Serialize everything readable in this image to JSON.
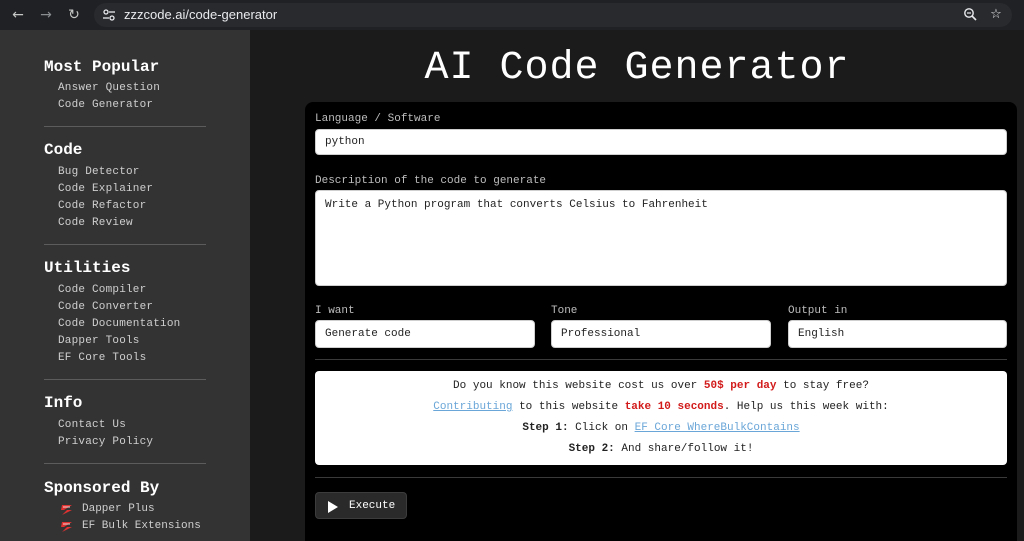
{
  "browser": {
    "url_domain": "zzzcode.ai",
    "url_path": "/code-generator",
    "icons": [
      "back-arrow-icon",
      "forward-arrow-icon",
      "reload-icon",
      "site-settings-icon",
      "zoom-icon",
      "star-icon"
    ]
  },
  "sidebar": {
    "sections": [
      {
        "title": "Most Popular",
        "links": [
          "Answer Question",
          "Code Generator"
        ]
      },
      {
        "title": "Code",
        "links": [
          "Bug Detector",
          "Code Explainer",
          "Code Refactor",
          "Code Review"
        ]
      },
      {
        "title": "Utilities",
        "links": [
          "Code Compiler",
          "Code Converter",
          "Code Documentation",
          "Dapper Tools",
          "EF Core Tools"
        ]
      },
      {
        "title": "Info",
        "links": [
          "Contact Us",
          "Privacy Policy"
        ]
      }
    ],
    "sponsored": {
      "title": "Sponsored By",
      "links": [
        "Dapper Plus",
        "EF Bulk Extensions"
      ]
    }
  },
  "main": {
    "title": "AI Code Generator",
    "form": {
      "language_label": "Language / Software",
      "language_value": "python",
      "description_label": "Description of the code to generate",
      "description_value": "Write a Python program that converts Celsius to Fahrenheit",
      "want_label": "I want",
      "want_value": "Generate code",
      "tone_label": "Tone",
      "tone_value": "Professional",
      "output_label": "Output in",
      "output_value": "English"
    },
    "notice": {
      "line1_pre": "Do you know this website cost us over ",
      "line1_highlight": "50$ per day",
      "line1_post": " to stay free?",
      "line2_link": "Contributing",
      "line2_mid": " to this website ",
      "line2_highlight": "take 10 seconds",
      "line2_post": ". Help us this week with:",
      "step1_label": "Step 1:",
      "step1_text": " Click on ",
      "step1_link": "EF Core WhereBulkContains",
      "step2_label": "Step 2:",
      "step2_text": " And share/follow it!"
    },
    "execute_label": "Execute"
  },
  "colors": {
    "sidebar_bg": "#333333",
    "main_bg": "#1b1b1b",
    "panel_bg": "#000000",
    "highlight_red": "#d21a1a",
    "link_blue": "#6aa6d8"
  }
}
